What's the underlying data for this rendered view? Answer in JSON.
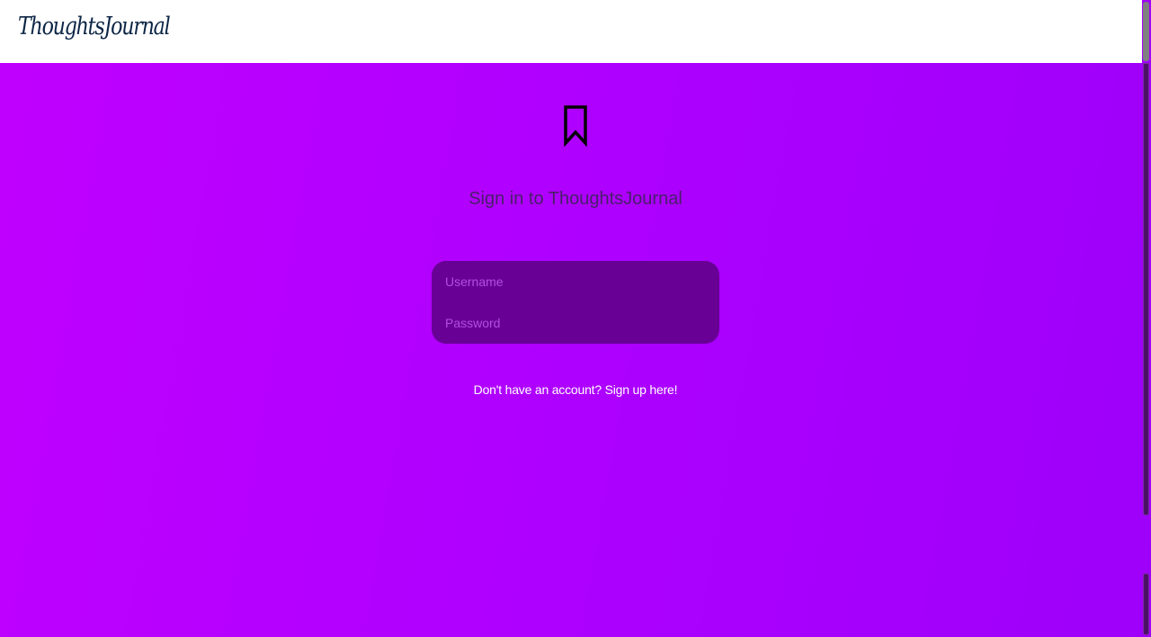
{
  "navbar": {
    "brand": "ThoughtsJournal"
  },
  "main": {
    "icon": "bookmark-icon",
    "title": "Sign in to ThoughtsJournal",
    "username_placeholder": "Username",
    "password_placeholder": "Password",
    "signup_link": "Don't have an account? Sign up here!"
  },
  "colors": {
    "background_gradient_start": "#c000ff",
    "background_gradient_end": "#9d00f9",
    "card": "#680096",
    "brand_text": "#0b2545"
  }
}
